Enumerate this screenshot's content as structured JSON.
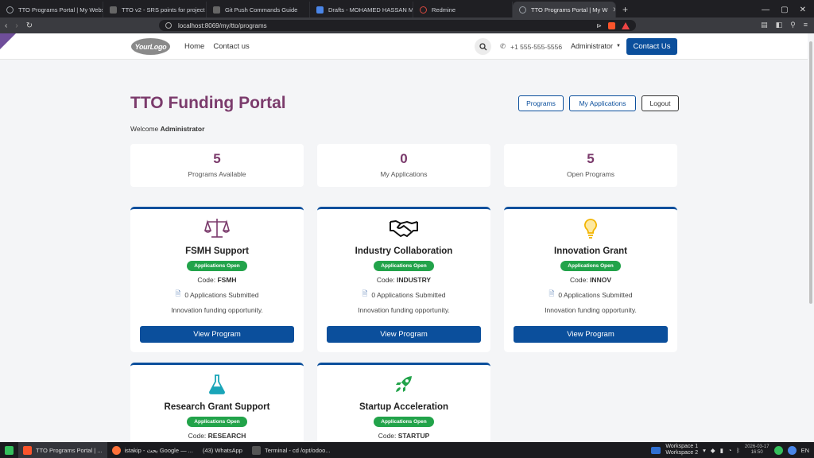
{
  "browser": {
    "tabs": [
      {
        "title": "TTO Programs Portal | My Webs",
        "active": false
      },
      {
        "title": "TTO v2 - SRS points for project",
        "active": false
      },
      {
        "title": "Git Push Commands Guide",
        "active": false
      },
      {
        "title": "Drafts - MOHAMED HASSAN MO",
        "active": false
      },
      {
        "title": "Redmine",
        "active": false
      },
      {
        "title": "TTO Programs Portal | My W",
        "active": true
      }
    ],
    "new_tab": "+",
    "url": "localhost:8069/my/tto/programs"
  },
  "nav": {
    "logo": "YourLogo",
    "links": [
      "Home",
      "Contact us"
    ],
    "phone": "+1 555-555-5556",
    "user": "Administrator",
    "contact_button": "Contact Us"
  },
  "header": {
    "title": "TTO Funding Portal",
    "welcome_prefix": "Welcome",
    "welcome_name": "Administrator",
    "buttons": [
      "Programs",
      "My Applications",
      "Logout"
    ]
  },
  "stats": [
    {
      "value": "5",
      "label": "Programs Available"
    },
    {
      "value": "0",
      "label": "My Applications"
    },
    {
      "value": "5",
      "label": "Open Programs"
    }
  ],
  "programs": [
    {
      "name": "FSMH Support",
      "status": "Applications Open",
      "code_label": "Code:",
      "code": "FSMH",
      "apps": "0 Applications Submitted",
      "desc": "Innovation funding opportunity.",
      "button": "View Program",
      "icon": "scale-icon",
      "icon_color": "#7b3b6c"
    },
    {
      "name": "Industry Collaboration",
      "status": "Applications Open",
      "code_label": "Code:",
      "code": "INDUSTRY",
      "apps": "0 Applications Submitted",
      "desc": "Innovation funding opportunity.",
      "button": "View Program",
      "icon": "handshake-icon",
      "icon_color": "#111111"
    },
    {
      "name": "Innovation Grant",
      "status": "Applications Open",
      "code_label": "Code:",
      "code": "INNOV",
      "apps": "0 Applications Submitted",
      "desc": "Innovation funding opportunity.",
      "button": "View Program",
      "icon": "lightbulb-icon",
      "icon_color": "#f2b400"
    },
    {
      "name": "Research Grant Support",
      "status": "Applications Open",
      "code_label": "Code:",
      "code": "RESEARCH",
      "icon": "flask-icon",
      "icon_color": "#1aa5b8"
    },
    {
      "name": "Startup Acceleration",
      "status": "Applications Open",
      "code_label": "Code:",
      "code": "STARTUP",
      "icon": "rocket-icon",
      "icon_color": "#22a34a"
    }
  ],
  "taskbar": {
    "items": [
      "TTO Programs Portal | ...",
      "istakip - بحث Google — ...",
      "(43) WhatsApp",
      "Terminal - cd /opt/odoo..."
    ],
    "workspaces": [
      "Workspace 1",
      "Workspace 2"
    ],
    "date": "2026-03-17",
    "time": "16:50",
    "lang": "EN"
  }
}
